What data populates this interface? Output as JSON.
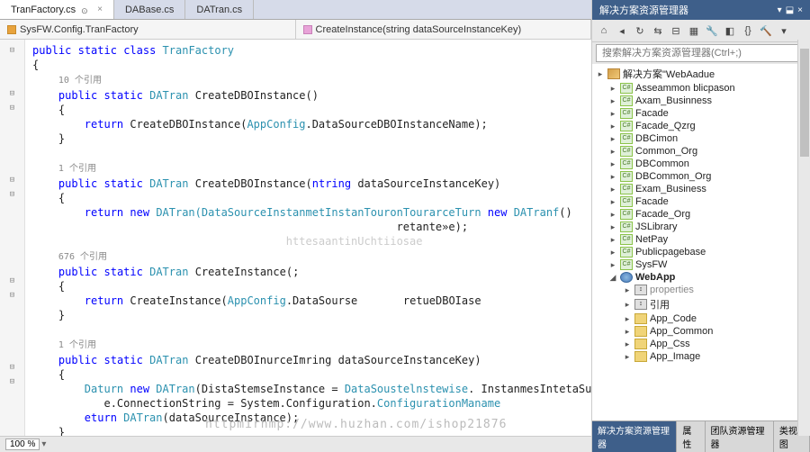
{
  "tabs": [
    {
      "label": "TranFactory.cs",
      "active": true,
      "pinned": true
    },
    {
      "label": "DABase.cs",
      "active": false
    },
    {
      "label": "DATran.cs",
      "active": false
    }
  ],
  "nav": {
    "left_icon": "class-icon",
    "left": "SysFW.Config.TranFactory",
    "right_icon": "method-icon",
    "right": "CreateInstance(string dataSourceInstanceKey)"
  },
  "code": {
    "line1_kw": [
      "public",
      "static",
      "class"
    ],
    "line1_type": "TranFactory",
    "ref1": "10 个引用",
    "m1_kw": [
      "public",
      "static"
    ],
    "m1_type": "DATran",
    "m1_name": "CreateDBOInstance",
    "m1_sig": "()",
    "m1_body_kw": "return",
    "m1_body_call": "CreateDBOInstance",
    "m1_body_arg_type": "AppConfig",
    "m1_body_arg_prop": ".DataSourceDBOInstanceName",
    "ref2": "1 个引用",
    "m2_kw": [
      "public",
      "static"
    ],
    "m2_type": "DATran",
    "m2_name": "CreateDBOInstance",
    "m2_sig_kw": "ntring",
    "m2_sig_arg": " dataSourceInstanceKey)",
    "m2_body_kw": [
      "return",
      "new"
    ],
    "m2_body_type": "DATran",
    "m2_body_args": "(DataSourceInstanmetInstanTouronTourarceTurn ",
    "m2_body_new": "new",
    "m2_body_type2": " DATranf",
    "m2_body_tail": "()",
    "m2_ret": "retante»e",
    "m2_blur": "httesaantinUchtiiosae",
    "ref3": "676 个引用",
    "m3_kw": [
      "public",
      "static"
    ],
    "m3_type": "DATran",
    "m3_name": "CreateInstance",
    "m3_sig": "(;",
    "m3_body_kw": "return",
    "m3_body_call": "CreateInstance",
    "m3_body_arg_type": "AppConfig",
    "m3_body_arg_prop": ".DataSourse",
    "m3_body_tail": "retueDBOIase",
    "ref4": "1 个引用",
    "m4_kw": [
      "public",
      "static"
    ],
    "m4_type": "DATran",
    "m4_name": "CreateDBOInurceImring",
    "m4_sig": " dataSourceInstanceKey)",
    "m4_l1a": "Daturn",
    "m4_l1_kw": " new ",
    "m4_l1_type": "DATran",
    "m4_l1b": "(DistaStemseInstance = ",
    "m4_l1_type2": "DataSoustelnstewise",
    "m4_l1c": ". InstanmesIntetaSunance",
    "m4_l2a": "           e.ConnectionString = System.Configuration.",
    "m4_l2_type": "ConfigurationManame",
    "m4_l3_kw": "eturn ",
    "m4_l3_type": "DATran",
    "m4_l3b": "(dataSourceInstance);"
  },
  "zoom": "100 %",
  "side": {
    "title": "解决方案资源管理器",
    "search_placeholder": "搜索解决方案资源管理器(Ctrl+;)",
    "solution": "解决方案\"WebAadue",
    "projects": [
      "Asseammon blicpason",
      "Axam_Businness",
      "Facade",
      "Facade_Qzrg",
      "DBCimon",
      "Common_Org",
      "DBCommon",
      "DBCommon_Org",
      "Exam_Business",
      "Facade",
      "Facade_Org",
      "JSLibrary",
      "NetPay",
      "Publicpagebase",
      "SysFW"
    ],
    "webapp": "WebApp",
    "webapp_children": {
      "properties": "properties",
      "references": "引用",
      "folders": [
        "App_Code",
        "App_Common",
        "App_Css",
        "App_Image"
      ]
    }
  },
  "bottom_tabs": [
    "解决方案资源管理器",
    "属性",
    "团队资源管理器",
    "类视图"
  ],
  "watermark": "httpmirhmp://www.huzhan.com/ishop21876"
}
